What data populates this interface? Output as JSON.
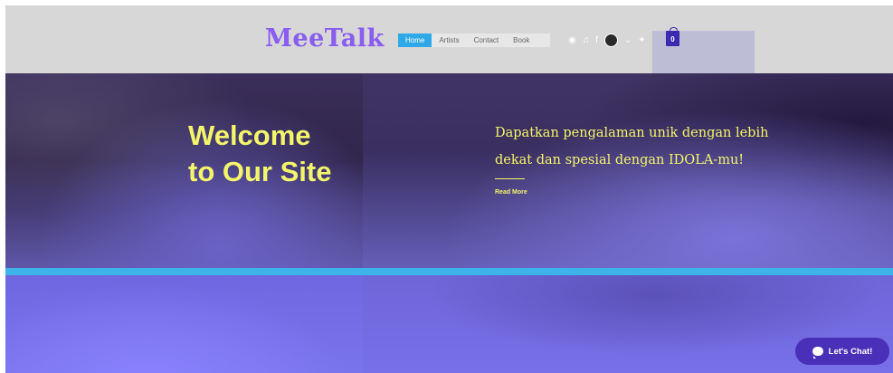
{
  "header": {
    "logo": "MeeTalk",
    "nav": [
      {
        "label": "Home",
        "active": true
      },
      {
        "label": "Artists",
        "active": false
      },
      {
        "label": "Contact",
        "active": false
      },
      {
        "label": "Book",
        "active": false
      }
    ],
    "social_icons": [
      "spotify-icon",
      "soundcloud-icon",
      "facebook-icon",
      "instagram-icon",
      "twitter-icon"
    ],
    "cart_count": "0"
  },
  "hero": {
    "welcome_line1": "Welcome",
    "welcome_line2": "to Our Site",
    "tagline": "Dapatkan pengalaman unik dengan lebih dekat dan spesial dengan IDOLA-mu!",
    "read_more": "Read More"
  },
  "chat": {
    "label": "Let's Chat!"
  },
  "colors": {
    "accent_yellow": "#f4f56a",
    "logo_purple": "#8a5cf0",
    "nav_active": "#2fa8e8",
    "stripe_blue": "#3cb4ea",
    "chat_button": "#4a2fb8"
  }
}
